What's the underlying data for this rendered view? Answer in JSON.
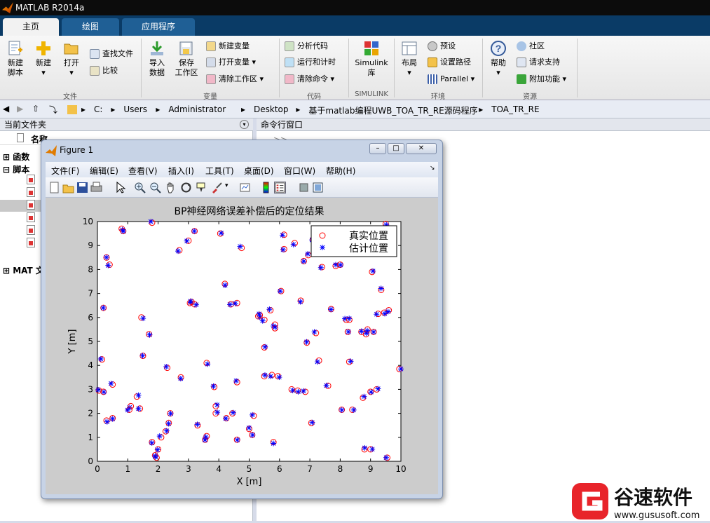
{
  "app": {
    "title": "MATLAB R2014a"
  },
  "tabs": [
    {
      "label": "主页"
    },
    {
      "label": "绘图"
    },
    {
      "label": "应用程序"
    }
  ],
  "ribbon": {
    "file": {
      "new_script": "新建\n脚本",
      "new": "新建",
      "open": "打开",
      "find_files": "查找文件",
      "compare": "比较",
      "group": "文件"
    },
    "variable": {
      "import": "导入\n数据",
      "save": "保存\n工作区",
      "new_var": "新建变量",
      "open_var": "打开变量",
      "clear_ws": "清除工作区",
      "group": "变量"
    },
    "code": {
      "analyze": "分析代码",
      "run_time": "运行和计时",
      "clear_cmd": "清除命令",
      "group": "代码"
    },
    "simulink": {
      "library": "Simulink\n库",
      "group": "SIMULINK"
    },
    "env": {
      "layout": "布局",
      "prefs": "预设",
      "set_path": "设置路径",
      "parallel": "Parallel",
      "group": "环境"
    },
    "resources": {
      "help": "帮助",
      "community": "社区",
      "support": "请求支持",
      "addons": "附加功能",
      "group": "资源"
    }
  },
  "address": {
    "crumbs": [
      "C:",
      "Users",
      "Administrator",
      "Desktop",
      "基于matlab编程UWB_TOA_TR_RE源码程序",
      "TOA_TR_RE"
    ]
  },
  "left_panel": {
    "title": "当前文件夹",
    "col_name": "名称",
    "tree": [
      "函数",
      "脚本",
      "MAT 文"
    ]
  },
  "right_panel": {
    "title": "命令行窗口",
    "cmd_partial": ">> "
  },
  "figure": {
    "title": "Figure 1",
    "menu": [
      "文件(F)",
      "编辑(E)",
      "查看(V)",
      "插入(I)",
      "工具(T)",
      "桌面(D)",
      "窗口(W)",
      "帮助(H)"
    ],
    "window_buttons": {
      "min": "–",
      "max": "□",
      "close": "✕"
    }
  },
  "chart_data": {
    "type": "scatter",
    "title": "BP神经网络误差补偿后的定位结果",
    "xlabel": "X  [m]",
    "ylabel": "Y  [m]",
    "xlim": [
      0,
      10
    ],
    "ylim": [
      0,
      10
    ],
    "xticks": [
      0,
      1,
      2,
      3,
      4,
      5,
      6,
      7,
      8,
      9,
      10
    ],
    "yticks": [
      0,
      1,
      2,
      3,
      4,
      5,
      6,
      7,
      8,
      9,
      10
    ],
    "legend_position": "top-right",
    "series": [
      {
        "name": "真实位置",
        "marker": "circle",
        "color": "#ff0000"
      },
      {
        "name": "估计位置",
        "marker": "star",
        "color": "#0000ff"
      }
    ],
    "points": [
      [
        0.3,
        8.5
      ],
      [
        0.4,
        8.2
      ],
      [
        0.2,
        6.4
      ],
      [
        0.5,
        3.2
      ],
      [
        0.2,
        2.9
      ],
      [
        0.05,
        2.95
      ],
      [
        0.3,
        1.7
      ],
      [
        0.5,
        1.8
      ],
      [
        0.8,
        9.7
      ],
      [
        0.85,
        9.6
      ],
      [
        1.1,
        2.3
      ],
      [
        1.3,
        2.7
      ],
      [
        1.4,
        2.2
      ],
      [
        1.45,
        6.0
      ],
      [
        1.5,
        4.4
      ],
      [
        1.7,
        5.3
      ],
      [
        1.8,
        9.95
      ],
      [
        1.8,
        0.8
      ],
      [
        1.9,
        0.25
      ],
      [
        1.95,
        0.15
      ],
      [
        2.0,
        0.5
      ],
      [
        2.1,
        1.0
      ],
      [
        2.3,
        3.9
      ],
      [
        2.35,
        1.6
      ],
      [
        2.4,
        2.0
      ],
      [
        2.25,
        1.25
      ],
      [
        2.7,
        8.8
      ],
      [
        2.75,
        3.5
      ],
      [
        3.0,
        9.2
      ],
      [
        3.05,
        6.6
      ],
      [
        3.2,
        6.55
      ],
      [
        3.2,
        9.6
      ],
      [
        3.3,
        1.5
      ],
      [
        3.55,
        0.9
      ],
      [
        3.6,
        1.05
      ],
      [
        3.6,
        4.1
      ],
      [
        3.85,
        3.1
      ],
      [
        3.9,
        2.3
      ],
      [
        3.9,
        2.0
      ],
      [
        4.05,
        9.5
      ],
      [
        4.2,
        7.4
      ],
      [
        4.25,
        1.8
      ],
      [
        4.4,
        6.55
      ],
      [
        4.45,
        2.0
      ],
      [
        4.6,
        3.3
      ],
      [
        4.6,
        6.6
      ],
      [
        4.6,
        0.9
      ],
      [
        4.75,
        8.9
      ],
      [
        5.0,
        1.35
      ],
      [
        5.1,
        1.1
      ],
      [
        5.15,
        1.9
      ],
      [
        5.3,
        6.05
      ],
      [
        5.5,
        5.9
      ],
      [
        5.5,
        4.75
      ],
      [
        5.5,
        3.55
      ],
      [
        5.7,
        6.3
      ],
      [
        5.75,
        3.6
      ],
      [
        5.85,
        5.7
      ],
      [
        5.85,
        5.55
      ],
      [
        5.95,
        3.55
      ],
      [
        5.8,
        0.8
      ],
      [
        6.05,
        7.1
      ],
      [
        6.15,
        9.45
      ],
      [
        6.15,
        8.85
      ],
      [
        6.4,
        3.0
      ],
      [
        6.5,
        9.1
      ],
      [
        6.6,
        2.95
      ],
      [
        6.7,
        6.7
      ],
      [
        6.8,
        8.35
      ],
      [
        6.85,
        2.9
      ],
      [
        6.9,
        4.95
      ],
      [
        6.95,
        8.6
      ],
      [
        7.05,
        1.6
      ],
      [
        7.1,
        9.25
      ],
      [
        7.2,
        5.35
      ],
      [
        7.3,
        4.2
      ],
      [
        7.4,
        8.1
      ],
      [
        7.6,
        3.15
      ],
      [
        7.7,
        6.35
      ],
      [
        7.85,
        8.15
      ],
      [
        8.05,
        2.15
      ],
      [
        8.2,
        5.9
      ],
      [
        8.25,
        5.4
      ],
      [
        8.3,
        4.15
      ],
      [
        8.3,
        5.9
      ],
      [
        8.4,
        2.15
      ],
      [
        8.7,
        5.4
      ],
      [
        8.75,
        2.65
      ],
      [
        8.8,
        0.5
      ],
      [
        8.85,
        5.3
      ],
      [
        8.9,
        5.5
      ],
      [
        9.0,
        0.5
      ],
      [
        9.0,
        2.9
      ],
      [
        9.05,
        7.9
      ],
      [
        9.1,
        5.4
      ],
      [
        9.2,
        3.0
      ],
      [
        9.25,
        6.15
      ],
      [
        9.35,
        7.15
      ],
      [
        9.45,
        6.2
      ],
      [
        9.5,
        9.9
      ],
      [
        9.55,
        0.15
      ],
      [
        9.6,
        6.3
      ],
      [
        9.95,
        3.85
      ],
      [
        1.05,
        2.15
      ],
      [
        0.15,
        4.25
      ],
      [
        3.1,
        6.65
      ],
      [
        5.35,
        6.1
      ],
      [
        8.0,
        8.2
      ]
    ],
    "estimated_offsets": "per-point small errors"
  }
}
